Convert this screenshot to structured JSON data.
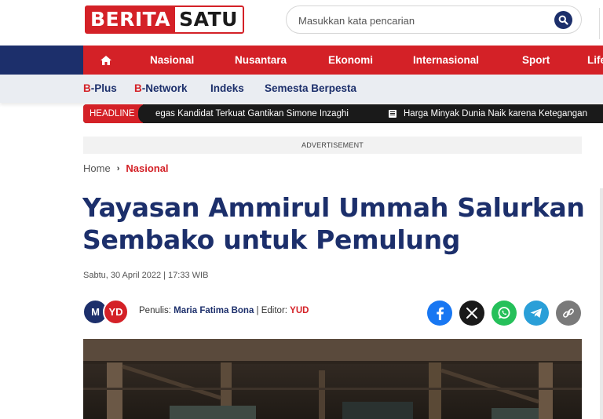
{
  "header": {
    "logo_part1": "BERITA",
    "logo_part2": "SATU",
    "search_placeholder": "Masukkan kata pencarian"
  },
  "main_nav": {
    "items": [
      "Nasional",
      "Nusantara",
      "Ekonomi",
      "Internasional",
      "Sport",
      "Lifestyle"
    ]
  },
  "sub_nav": {
    "items": [
      {
        "prefix": "B",
        "rest": "-Plus"
      },
      {
        "prefix": "B",
        "rest": "-Network"
      },
      {
        "prefix": "",
        "rest": "Indeks"
      },
      {
        "prefix": "",
        "rest": "Semesta Berpesta"
      }
    ]
  },
  "ticker": {
    "label": "HEADLINE",
    "item1": "egas Kandidat Terkuat Gantikan Simone Inzaghi",
    "item2": "Harga Minyak Dunia Naik karena Ketegangan"
  },
  "ad_label": "ADVERTISEMENT",
  "breadcrumb": {
    "home": "Home",
    "separator": "›",
    "current": "Nasional"
  },
  "article": {
    "title": "Yayasan Ammirul Ummah Salurkan Sembako untuk Pemulung",
    "date": "Sabtu, 30 April 2022 | 17:33 WIB",
    "avatar1": "M",
    "avatar2": "YD",
    "writer_label": "Penulis: ",
    "writer": "Maria Fatima Bona",
    "editor_label": " | Editor: ",
    "editor": "YUD"
  },
  "colors": {
    "brand_red": "#d42127",
    "brand_navy": "#1c2f6b",
    "facebook": "#1877f2",
    "x": "#1a1a1a",
    "whatsapp": "#25c05a",
    "telegram": "#2a9fd8",
    "link": "#7a7a7a"
  }
}
